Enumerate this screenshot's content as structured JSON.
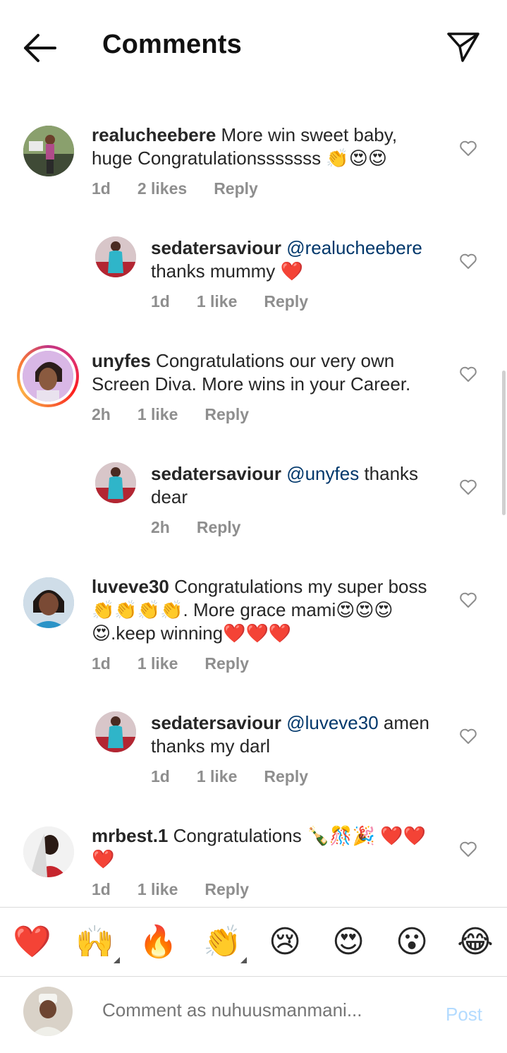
{
  "header": {
    "title": "Comments",
    "back_icon": "arrow-left-icon",
    "send_icon": "paper-plane-icon"
  },
  "comments": [
    {
      "username": "realucheebere",
      "mention": "",
      "text": " More win sweet baby, huge Congratulationsssssss 👏😍😍",
      "time": "1d",
      "likes": "2 likes",
      "reply": "Reply",
      "is_reply": false
    },
    {
      "username": "sedatersaviour",
      "mention": " @realucheebere",
      "text": " thanks mummy ❤️",
      "time": "1d",
      "likes": "1 like",
      "reply": "Reply",
      "is_reply": true
    },
    {
      "username": "unyfes",
      "mention": "",
      "text": " Congratulations our very own Screen Diva. More wins in your Career.",
      "time": "2h",
      "likes": "1 like",
      "reply": "Reply",
      "is_reply": false
    },
    {
      "username": "sedatersaviour",
      "mention": " @unyfes",
      "text": " thanks dear",
      "time": "2h",
      "likes": "",
      "reply": "Reply",
      "is_reply": true
    },
    {
      "username": "luveve30",
      "mention": "",
      "text": " Congratulations my super boss👏👏👏👏. More grace mami😍😍😍😍.keep winning❤️❤️❤️",
      "time": "1d",
      "likes": "1 like",
      "reply": "Reply",
      "is_reply": false
    },
    {
      "username": "sedatersaviour",
      "mention": " @luveve30",
      "text": " amen thanks my darl",
      "time": "1d",
      "likes": "1 like",
      "reply": "Reply",
      "is_reply": true
    },
    {
      "username": "mrbest.1",
      "mention": "",
      "text": " Congratulations 🍾🎊🎉 ❤️❤️❤️",
      "time": "1d",
      "likes": "1 like",
      "reply": "Reply",
      "is_reply": false
    }
  ],
  "emoji_bar": [
    "❤️",
    "🙌",
    "🔥",
    "👏",
    "😢",
    "😍",
    "😮",
    "😂"
  ],
  "input": {
    "placeholder": "Comment as nuhuusmanmani...",
    "post_label": "Post"
  },
  "colors": {
    "username": "#262626",
    "mention": "#00376b",
    "meta": "#8e8e8e",
    "post_disabled": "#b3dbff"
  }
}
